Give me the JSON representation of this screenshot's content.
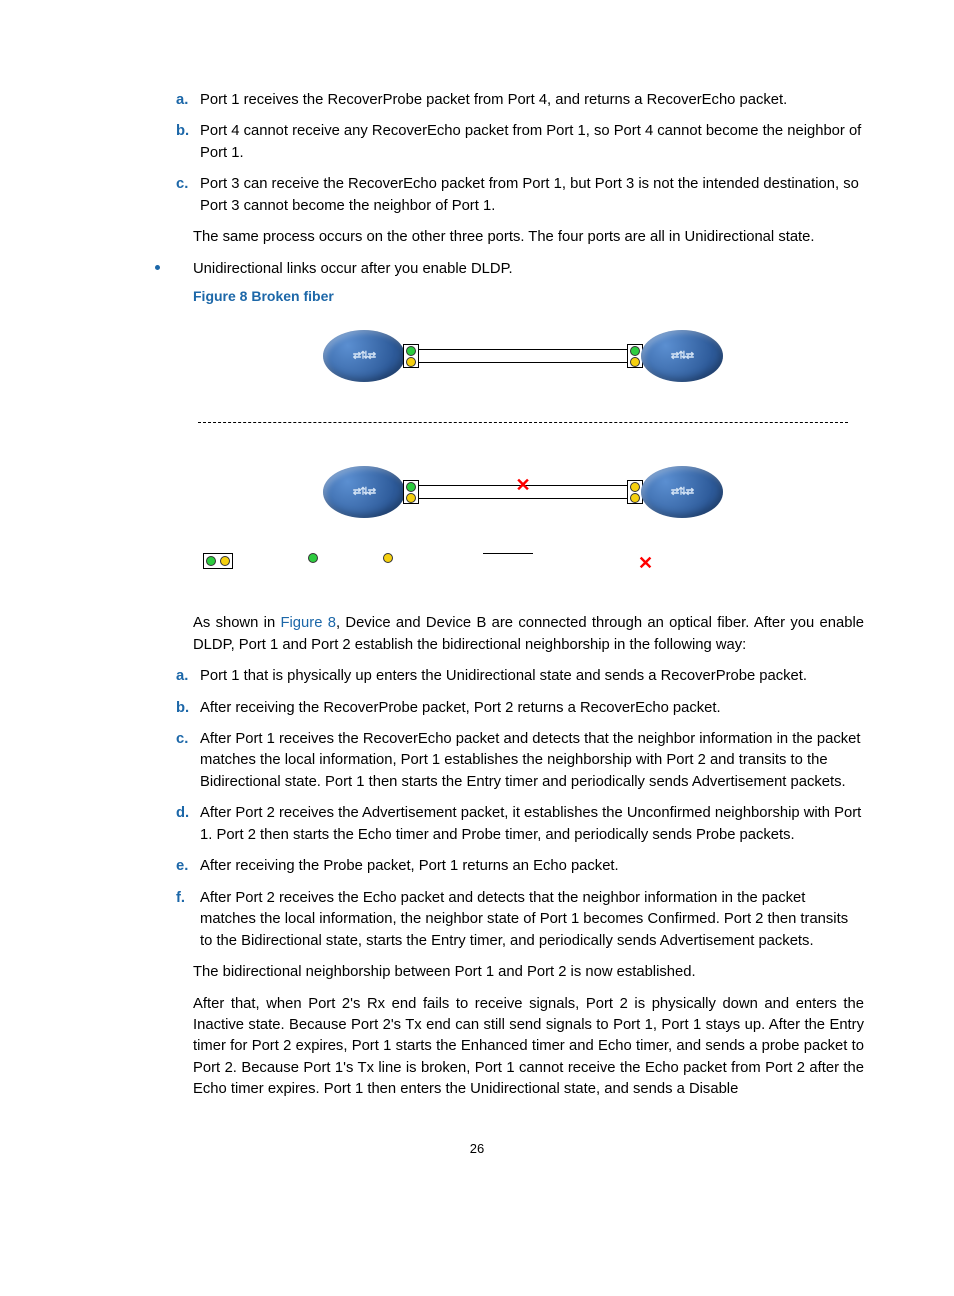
{
  "list1": {
    "a": "Port 1 receives the RecoverProbe packet from Port 4, and returns a RecoverEcho packet.",
    "b": "Port 4 cannot receive any RecoverEcho packet from Port 1, so Port 4 cannot become the neighbor of Port 1.",
    "c": "Port 3 can receive the RecoverEcho packet from Port 1, but Port 3 is not the intended destination, so Port 3 cannot become the neighbor of Port 1."
  },
  "after_list1": "The same process occurs on the other three ports. The four ports are all in Unidirectional state.",
  "bullet1": "Unidirectional links occur after you enable DLDP.",
  "fig_caption": "Figure 8 Broken fiber",
  "intro2_prefix": "As shown in ",
  "intro2_linktext": "Figure 8",
  "intro2_suffix": ", Device and Device B are connected through an optical fiber. After you enable DLDP, Port 1 and Port 2 establish the bidirectional neighborship in the following way:",
  "list2": {
    "a": "Port 1 that is physically up enters the Unidirectional state and sends a RecoverProbe packet.",
    "b": "After receiving the RecoverProbe packet, Port 2 returns a RecoverEcho packet.",
    "c": "After Port 1 receives the RecoverEcho packet and detects that the neighbor information in the packet matches the local information, Port 1 establishes the neighborship with Port 2 and transits to the Bidirectional state. Port 1 then starts the Entry timer and periodically sends Advertisement packets.",
    "d": "After Port 2 receives the Advertisement packet, it establishes the Unconfirmed neighborship with Port 1. Port 2 then starts the Echo timer and Probe timer, and periodically sends Probe packets.",
    "e": "After receiving the Probe packet, Port 1 returns an Echo packet.",
    "f": "After Port 2 receives the Echo packet and detects that the neighbor information in the packet matches the local information, the neighbor state of Port 1 becomes Confirmed. Port 2 then transits to the Bidirectional state, starts the Entry timer, and periodically sends Advertisement packets."
  },
  "after_list2": "The bidirectional neighborship between Port 1 and Port 2 is now established.",
  "final_para": "After that, when Port 2's Rx end fails to receive signals, Port 2 is physically down and enters the Inactive state. Because Port 2's Tx end can still send signals to Port 1, Port 1 stays up. After the Entry timer for Port 2 expires, Port 1 starts the Enhanced timer and Echo timer, and sends a probe packet to Port 2. Because Port 1's Tx line is broken, Port 1 cannot receive the Echo packet from Port 2 after the Echo timer expires. Port 1 then enters the Unidirectional state, and sends a Disable",
  "page_number": "26"
}
